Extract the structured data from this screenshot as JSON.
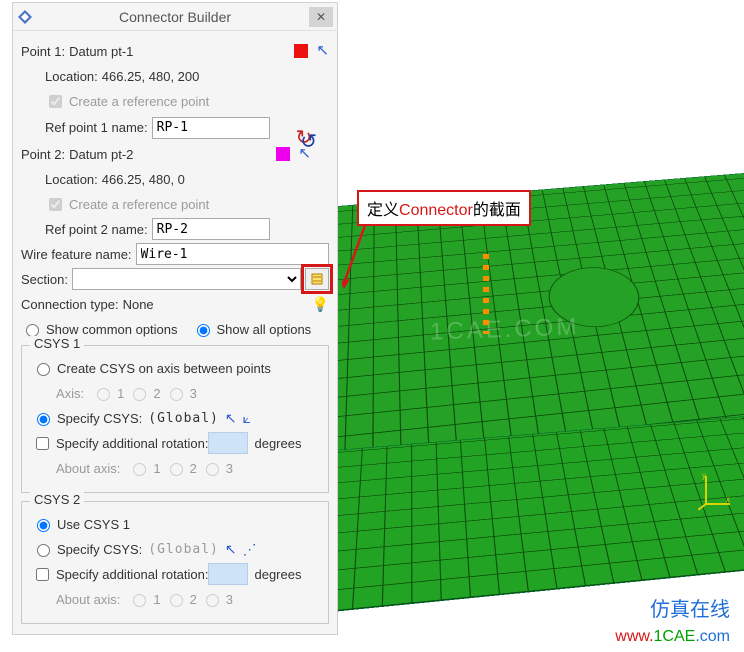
{
  "title": "Connector Builder",
  "point1": {
    "label": "Point 1:",
    "datum": "Datum pt-1",
    "loc_label": "Location:",
    "location": "466.25, 480, 200",
    "create_ref": "Create a reference point",
    "ref_label": "Ref point 1 name:",
    "ref_value": "RP-1"
  },
  "point2": {
    "label": "Point 2:",
    "datum": "Datum pt-2",
    "loc_label": "Location:",
    "location": "466.25, 480, 0",
    "create_ref": "Create a reference point",
    "ref_label": "Ref point 2 name:",
    "ref_value": "RP-2"
  },
  "wire": {
    "label": "Wire feature name:",
    "value": "Wire-1"
  },
  "section": {
    "label": "Section:",
    "value": ""
  },
  "conn_type": {
    "label": "Connection type:",
    "value": "None"
  },
  "options": {
    "common": "Show common options",
    "all": "Show all options"
  },
  "csys1": {
    "title": "CSYS 1",
    "create": "Create CSYS on axis between points",
    "axis_lbl": "Axis:",
    "a1": "1",
    "a2": "2",
    "a3": "3",
    "specify": "Specify CSYS:",
    "global": "(Global)",
    "addl": "Specify additional rotation:",
    "degrees": "degrees",
    "about": "About axis:"
  },
  "csys2": {
    "title": "CSYS 2",
    "use1": "Use CSYS 1",
    "specify": "Specify CSYS:",
    "global": "(Global)",
    "addl": "Specify additional rotation:",
    "degrees": "degrees",
    "about": "About axis:"
  },
  "callout": {
    "p1": "定义",
    "p2": "Connector",
    "p3": "的截面"
  },
  "footer": {
    "cn": "仿真在线",
    "w": "www.",
    "d": "1CAE",
    "c": ".com"
  },
  "watermark": "1CAE.COM"
}
